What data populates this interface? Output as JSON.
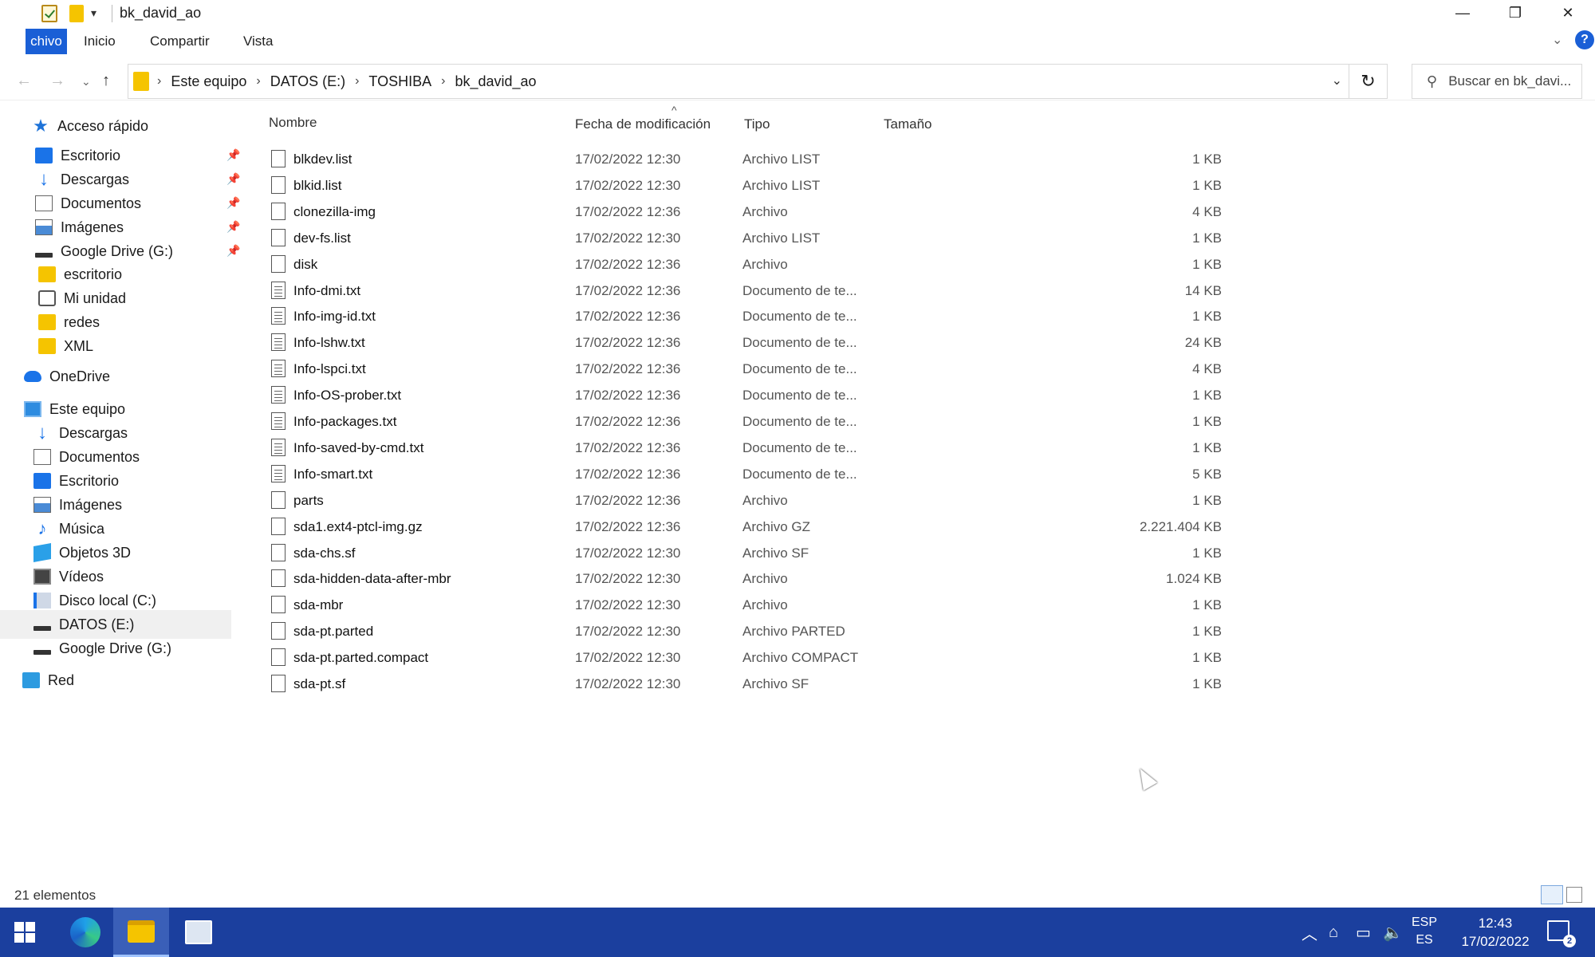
{
  "window": {
    "title": "bk_david_ao",
    "minimize": "—",
    "restore": "❐",
    "close": "✕"
  },
  "ribbon": {
    "tabs": [
      "chivo",
      "Inicio",
      "Compartir",
      "Vista"
    ],
    "help": "?"
  },
  "address": {
    "segments": [
      "Este equipo",
      "DATOS (E:)",
      "TOSHIBA",
      "bk_david_ao"
    ],
    "search_placeholder": "Buscar en bk_davi..."
  },
  "nav": {
    "items": [
      {
        "label": "Acceso rápido",
        "icon": "star-icon"
      },
      {
        "label": "Escritorio",
        "icon": "desktop-icon",
        "pinned": true
      },
      {
        "label": "Descargas",
        "icon": "download-icon",
        "pinned": true
      },
      {
        "label": "Documentos",
        "icon": "documents-icon",
        "pinned": true
      },
      {
        "label": "Imágenes",
        "icon": "pictures-icon",
        "pinned": true
      },
      {
        "label": "Google Drive (G:)",
        "icon": "drive-icon",
        "pinned": true
      },
      {
        "label": "escritorio",
        "icon": "folder-icon"
      },
      {
        "label": "Mi unidad",
        "icon": "google-drive-icon"
      },
      {
        "label": "redes",
        "icon": "folder-icon"
      },
      {
        "label": "XML",
        "icon": "folder-icon"
      },
      {
        "label": "OneDrive",
        "icon": "cloud-icon"
      },
      {
        "label": "Este equipo",
        "icon": "computer-icon"
      },
      {
        "label": "Descargas",
        "icon": "download-icon"
      },
      {
        "label": "Documentos",
        "icon": "documents-icon"
      },
      {
        "label": "Escritorio",
        "icon": "desktop-icon"
      },
      {
        "label": "Imágenes",
        "icon": "pictures-icon"
      },
      {
        "label": "Música",
        "icon": "music-icon"
      },
      {
        "label": "Objetos 3D",
        "icon": "3d-objects-icon"
      },
      {
        "label": "Vídeos",
        "icon": "videos-icon"
      },
      {
        "label": "Disco local (C:)",
        "icon": "local-disk-icon"
      },
      {
        "label": "DATOS (E:)",
        "icon": "drive-icon",
        "selected": true
      },
      {
        "label": "Google Drive (G:)",
        "icon": "drive-icon"
      },
      {
        "label": "Red",
        "icon": "network-icon"
      }
    ]
  },
  "columns": {
    "name": "Nombre",
    "date": "Fecha de modificación",
    "type": "Tipo",
    "size": "Tamaño"
  },
  "files": [
    {
      "name": "blkdev.list",
      "date": "17/02/2022 12:30",
      "type": "Archivo LIST",
      "size": "1 KB",
      "icon": "file-icon"
    },
    {
      "name": "blkid.list",
      "date": "17/02/2022 12:30",
      "type": "Archivo LIST",
      "size": "1 KB",
      "icon": "file-icon"
    },
    {
      "name": "clonezilla-img",
      "date": "17/02/2022 12:36",
      "type": "Archivo",
      "size": "4 KB",
      "icon": "file-icon"
    },
    {
      "name": "dev-fs.list",
      "date": "17/02/2022 12:30",
      "type": "Archivo LIST",
      "size": "1 KB",
      "icon": "file-icon"
    },
    {
      "name": "disk",
      "date": "17/02/2022 12:36",
      "type": "Archivo",
      "size": "1 KB",
      "icon": "file-icon"
    },
    {
      "name": "Info-dmi.txt",
      "date": "17/02/2022 12:36",
      "type": "Documento de te...",
      "size": "14 KB",
      "icon": "text-file-icon"
    },
    {
      "name": "Info-img-id.txt",
      "date": "17/02/2022 12:36",
      "type": "Documento de te...",
      "size": "1 KB",
      "icon": "text-file-icon"
    },
    {
      "name": "Info-lshw.txt",
      "date": "17/02/2022 12:36",
      "type": "Documento de te...",
      "size": "24 KB",
      "icon": "text-file-icon"
    },
    {
      "name": "Info-lspci.txt",
      "date": "17/02/2022 12:36",
      "type": "Documento de te...",
      "size": "4 KB",
      "icon": "text-file-icon"
    },
    {
      "name": "Info-OS-prober.txt",
      "date": "17/02/2022 12:36",
      "type": "Documento de te...",
      "size": "1 KB",
      "icon": "text-file-icon"
    },
    {
      "name": "Info-packages.txt",
      "date": "17/02/2022 12:36",
      "type": "Documento de te...",
      "size": "1 KB",
      "icon": "text-file-icon"
    },
    {
      "name": "Info-saved-by-cmd.txt",
      "date": "17/02/2022 12:36",
      "type": "Documento de te...",
      "size": "1 KB",
      "icon": "text-file-icon"
    },
    {
      "name": "Info-smart.txt",
      "date": "17/02/2022 12:36",
      "type": "Documento de te...",
      "size": "5 KB",
      "icon": "text-file-icon"
    },
    {
      "name": "parts",
      "date": "17/02/2022 12:36",
      "type": "Archivo",
      "size": "1 KB",
      "icon": "file-icon"
    },
    {
      "name": "sda1.ext4-ptcl-img.gz",
      "date": "17/02/2022 12:36",
      "type": "Archivo GZ",
      "size": "2.221.404 KB",
      "icon": "file-icon"
    },
    {
      "name": "sda-chs.sf",
      "date": "17/02/2022 12:30",
      "type": "Archivo SF",
      "size": "1 KB",
      "icon": "file-icon"
    },
    {
      "name": "sda-hidden-data-after-mbr",
      "date": "17/02/2022 12:30",
      "type": "Archivo",
      "size": "1.024 KB",
      "icon": "file-icon"
    },
    {
      "name": "sda-mbr",
      "date": "17/02/2022 12:30",
      "type": "Archivo",
      "size": "1 KB",
      "icon": "file-icon"
    },
    {
      "name": "sda-pt.parted",
      "date": "17/02/2022 12:30",
      "type": "Archivo PARTED",
      "size": "1 KB",
      "icon": "file-icon"
    },
    {
      "name": "sda-pt.parted.compact",
      "date": "17/02/2022 12:30",
      "type": "Archivo COMPACT",
      "size": "1 KB",
      "icon": "file-icon"
    },
    {
      "name": "sda-pt.sf",
      "date": "17/02/2022 12:30",
      "type": "Archivo SF",
      "size": "1 KB",
      "icon": "file-icon"
    }
  ],
  "status": {
    "count_text": "21 elementos"
  },
  "taskbar": {
    "lang_top": "ESP",
    "lang_bottom": "ES",
    "time": "12:43",
    "date": "17/02/2022",
    "notifications": "2"
  },
  "colors": {
    "accent": "#1a5fd6",
    "taskbar": "#1b3f9e",
    "folder": "#f5c400"
  }
}
